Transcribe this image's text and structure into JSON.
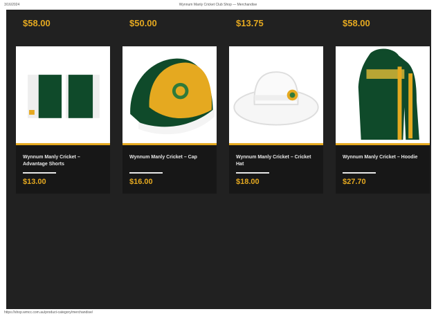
{
  "print_header": {
    "date": "3/16/2024",
    "title": "Wynnum Manly Cricket Club Shop — Merchandise"
  },
  "print_footer": {
    "url": "https://shop.wmcc.com.au/product-category/merchandise/"
  },
  "top_prices": [
    "$58.00",
    "$50.00",
    "$13.75",
    "$58.00"
  ],
  "products": [
    {
      "name": "Wynnum Manly Cricket – Advantage Shorts",
      "price": "$13.00",
      "icon": "shorts-icon"
    },
    {
      "name": "Wynnum Manly Cricket – Cap",
      "price": "$16.00",
      "icon": "cap-icon"
    },
    {
      "name": "Wynnum Manly Cricket – Cricket Hat",
      "price": "$18.00",
      "icon": "hat-icon"
    },
    {
      "name": "Wynnum Manly Cricket – Hoodie",
      "price": "$27.70",
      "icon": "hoodie-icon"
    }
  ],
  "colors": {
    "accent": "#e5a920",
    "green": "#0f4a2a",
    "background": "#212121",
    "card": "#171717"
  }
}
